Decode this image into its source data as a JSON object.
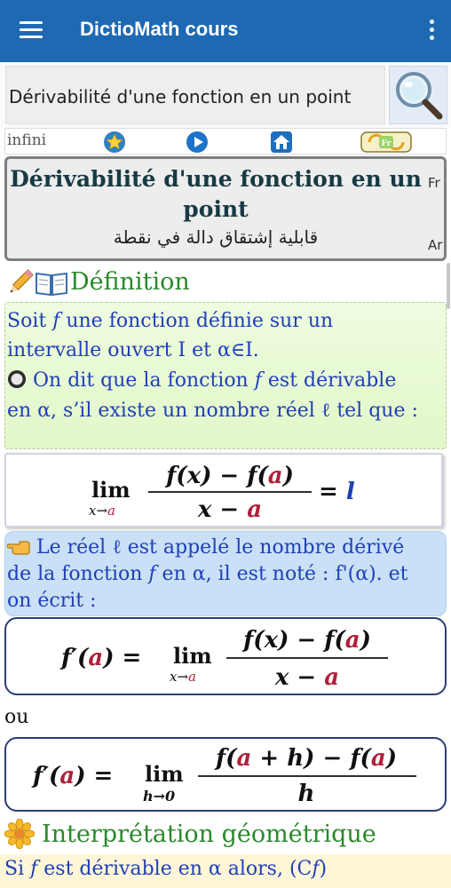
{
  "appbar": {
    "title": "DictioMath cours",
    "menu_icon": "hamburger-menu-icon",
    "more_icon": "vertical-dots-icon",
    "color": "#1e69b2"
  },
  "search": {
    "value": "Dérivabilité d'une fonction en un point",
    "button_icon": "magnifier-icon"
  },
  "toolbar": {
    "infini_label": "infini",
    "icons": [
      "star-icon",
      "play-icon",
      "home-icon",
      "language-switch-icon"
    ],
    "lang_badge": "Fr"
  },
  "header": {
    "title_fr": "Dérivabilité d'une fonction en un point",
    "title_ar": "قابلية إشتقاق دالة في نقطة",
    "lang_fr": "Fr",
    "lang_ar": "Ar"
  },
  "definition": {
    "section_label": "Définition",
    "icons": [
      "pencil-icon",
      "book-icon"
    ],
    "line1_pre": "Soit ",
    "line1_f": "f",
    "line1_post": " une fonction définie sur un",
    "line2": "intervalle ouvert I et α∈I.",
    "line3_pre": "On dit que la fonction ",
    "line3_f": "f",
    "line3_post": " est dérivable",
    "line4": "en α, s’il existe un nombre réel ℓ tel que :",
    "bullet_icon": "radio-bullet-icon"
  },
  "formula1": {
    "lim": "lim",
    "sub_pre": "x→",
    "sub_a": "a",
    "num_pre": "f(x) − f(",
    "num_a": "a",
    "num_post": ")",
    "den_pre": "x − ",
    "den_a": "a",
    "eq": "= ",
    "result": "l"
  },
  "note": {
    "icon": "pointing-hand-icon",
    "line1": "Le réel ℓ est appelé le nombre dérivé",
    "line2_pre": "de la fonction ",
    "line2_f": "f",
    "line2_post": " en α, il est noté : f'(α).  et",
    "line3": "on écrit :"
  },
  "formula2": {
    "lhs_pre": "f′(",
    "lhs_a": "a",
    "lhs_post": ") = ",
    "lim": "lim",
    "sub_pre": "x→",
    "sub_a": "a",
    "num_pre": "f(x) − f(",
    "num_a": "a",
    "num_post": ")",
    "den_pre": "x − ",
    "den_a": "a"
  },
  "ou_label": "ou",
  "formula3": {
    "lhs_pre": "f′(",
    "lhs_a": "a",
    "lhs_post": ") = ",
    "lim": "lim",
    "sub": "h→0",
    "num_pre": "f(",
    "num_a": "a",
    "num_mid": " + h) − f(",
    "num_a2": "a",
    "num_post": ")",
    "den": "h"
  },
  "interpretation": {
    "section_label": "Interprétation géométrique",
    "icon": "sunflower-icon",
    "line_pre": "Si ",
    "line_f": "f",
    "line_post": " est dérivable  en α alors, (C",
    "line_f2": "f",
    "line_end": ")"
  },
  "colors": {
    "accent_red": "#b0203a",
    "blue_text": "#1f3fb8",
    "green_heading": "#2a8a2a"
  }
}
